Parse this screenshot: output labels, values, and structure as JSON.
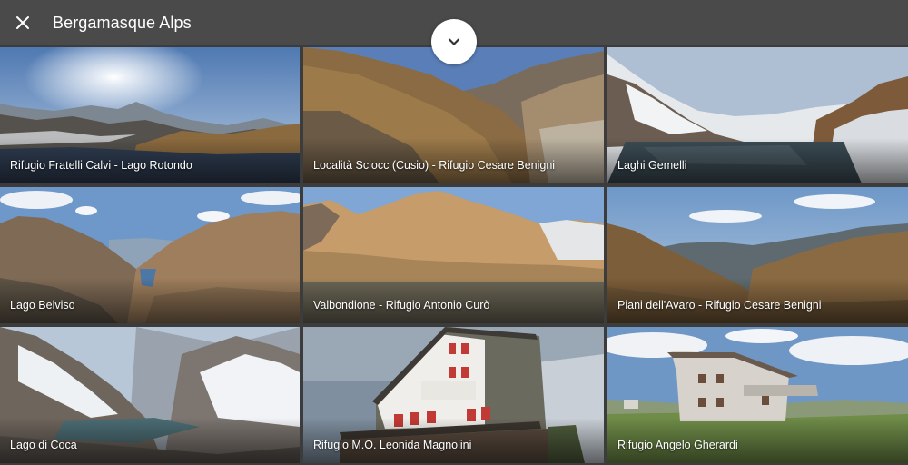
{
  "header": {
    "title": "Bergamasque Alps",
    "close_icon": "close-icon",
    "collapse_icon": "chevron-down-icon"
  },
  "tiles": [
    {
      "label": "Rifugio Fratelli Calvi - Lago Rotondo"
    },
    {
      "label": "Località Sciocc (Cusio) - Rifugio Cesare Benigni"
    },
    {
      "label": "Laghi Gemelli"
    },
    {
      "label": "Lago Belviso"
    },
    {
      "label": "Valbondione - Rifugio Antonio Curò"
    },
    {
      "label": "Piani dell'Avaro - Rifugio Cesare Benigni"
    },
    {
      "label": "Lago di Coca"
    },
    {
      "label": "Rifugio M.O. Leonida Magnolini"
    },
    {
      "label": "Rifugio Angelo Gherardi"
    }
  ]
}
